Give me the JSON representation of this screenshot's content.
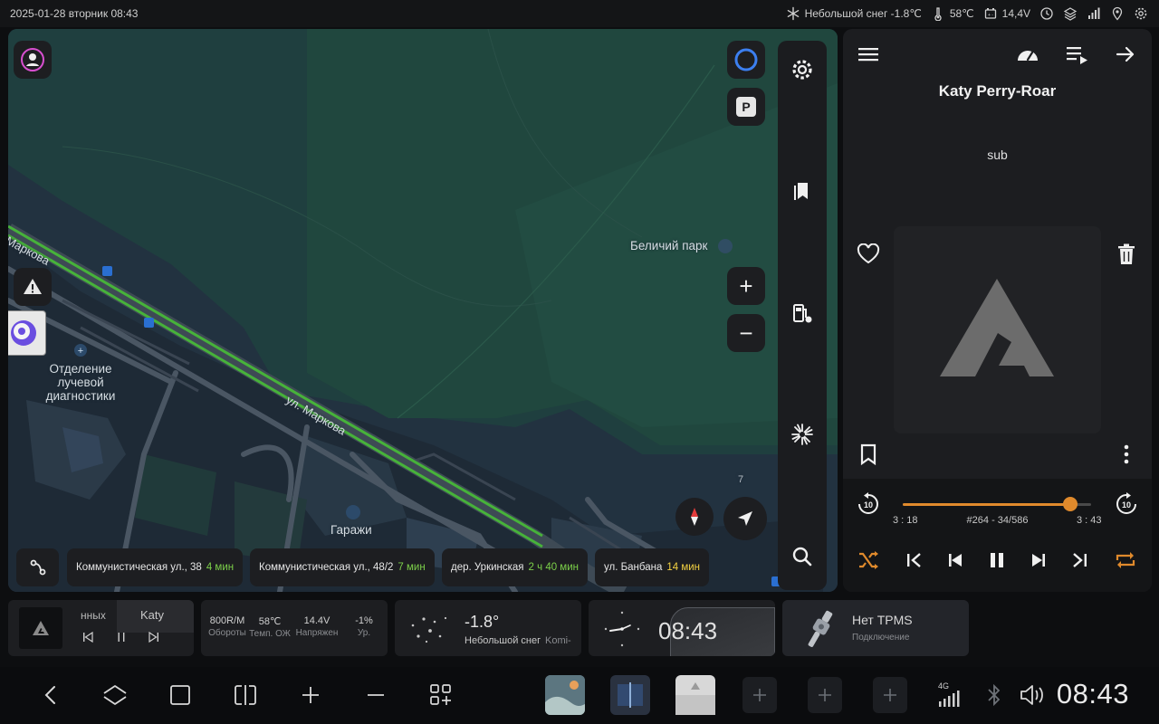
{
  "status": {
    "datetime": "2025-01-28 вторник 08:43",
    "weather": "Небольшой снег -1.8℃",
    "coolant_temp": "58℃",
    "voltage": "14,4V"
  },
  "map": {
    "labels": {
      "street_markova_top": "Маркова",
      "street_markova": "ул. Маркова",
      "park": "Беличий парк",
      "hospital_line1": "Отделение",
      "hospital_line2": "лучевой",
      "hospital_line3": "диагностики",
      "garages": "Гаражи",
      "house_number": "7"
    },
    "parking_label": "P",
    "zoom_in": "+",
    "zoom_out": "−",
    "destinations": [
      {
        "address": "Коммунистическая ул., 38",
        "eta": "4 мин",
        "color": "green"
      },
      {
        "address": "Коммунистическая ул., 48/2",
        "eta": "7 мин",
        "color": "green"
      },
      {
        "address": "дер. Уркинская",
        "eta": "2 ч 40 мин",
        "color": "green"
      },
      {
        "address": "ул. Банбана",
        "eta": "14 мин",
        "color": "yellow"
      }
    ]
  },
  "music": {
    "title": "Katy Perry-Roar",
    "subtitle": "sub",
    "time_current": "3 : 18",
    "time_total": "3 : 43",
    "track_index": "#264 - 34/586",
    "progress": 0.89,
    "accent": "#e08a2c"
  },
  "widgets": {
    "mini_player": {
      "left_text": "нных",
      "right_text": "Katy"
    },
    "car": {
      "items": [
        {
          "value": "800R/M",
          "label": "Обороты"
        },
        {
          "value": "58℃",
          "label": "Темп. ОЖ"
        },
        {
          "value": "14.4V",
          "label": "Напряжен"
        },
        {
          "value": "-1%",
          "label": "Ур."
        }
      ]
    },
    "weather": {
      "temp": "-1.8°",
      "desc": "Небольшой снег",
      "city": "Komi-"
    },
    "clock": {
      "time": "08:43"
    },
    "tpms": {
      "title": "Нет TPMS",
      "subtitle": "Подключение"
    }
  },
  "navbar": {
    "clock": "08:43",
    "network": "4G"
  }
}
